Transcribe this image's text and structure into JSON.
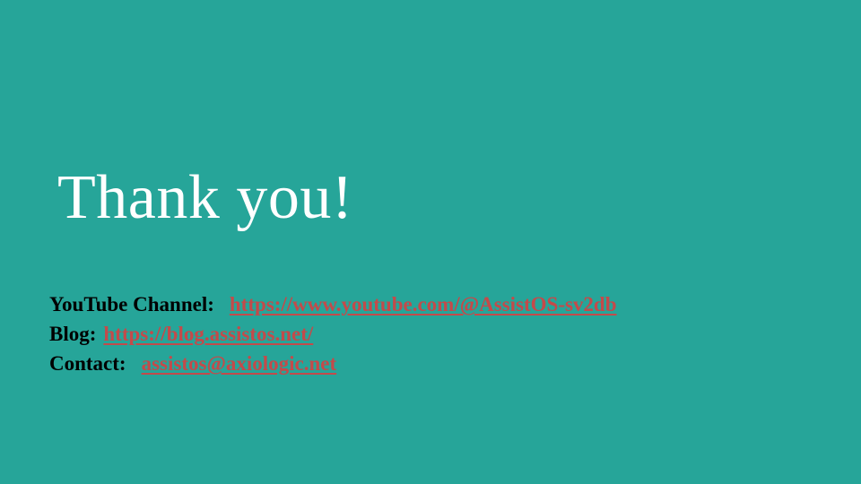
{
  "slide": {
    "title": "Thank you!",
    "colors": {
      "background": "#26a599",
      "title": "#ffffff",
      "label": "#000000",
      "link": "#c44a4a"
    },
    "contacts": [
      {
        "label": "YouTube Channel:",
        "link": "https://www.youtube.com/@AssistOS-sv2db"
      },
      {
        "label": "Blog:",
        "link": "https://blog.assistos.net/"
      },
      {
        "label": "Contact:",
        "link": "assistos@axiologic.net"
      }
    ]
  }
}
